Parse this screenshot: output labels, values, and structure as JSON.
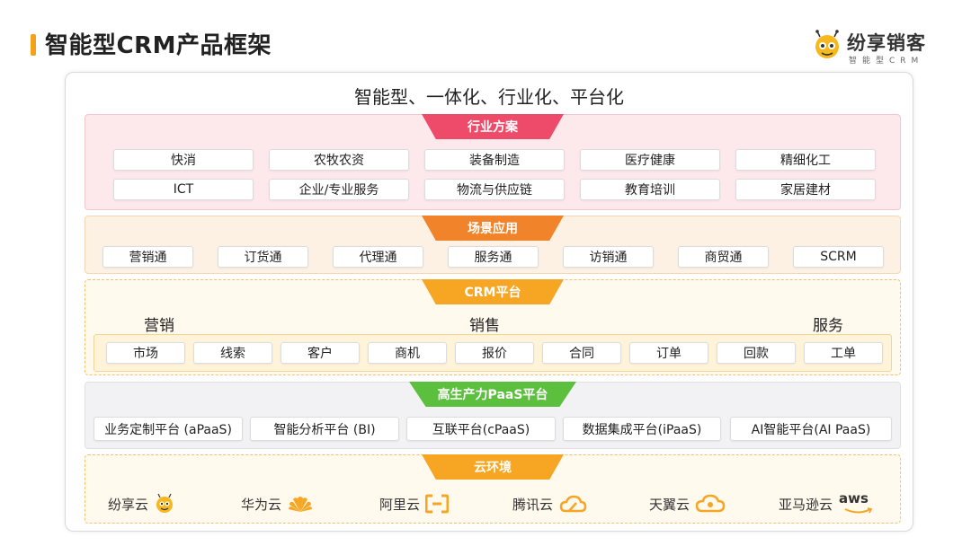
{
  "header": {
    "title": "智能型CRM产品框架",
    "logo_name": "纷享销客",
    "logo_sub": "智能型CRM"
  },
  "main_heading": "智能型、一体化、行业化、平台化",
  "industry": {
    "label": "行业方案",
    "row1": [
      "快消",
      "农牧农资",
      "装备制造",
      "医疗健康",
      "精细化工"
    ],
    "row2": [
      "ICT",
      "企业/专业服务",
      "物流与供应链",
      "教育培训",
      "家居建材"
    ]
  },
  "scene": {
    "label": "场景应用",
    "items": [
      "营销通",
      "订货通",
      "代理通",
      "服务通",
      "访销通",
      "商贸通",
      "SCRM"
    ]
  },
  "crm": {
    "label": "CRM平台",
    "groups": [
      "营销",
      "销售",
      "服务"
    ],
    "items": [
      "市场",
      "线索",
      "客户",
      "商机",
      "报价",
      "合同",
      "订单",
      "回款",
      "工单"
    ]
  },
  "paas": {
    "label": "高生产力PaaS平台",
    "items": [
      "业务定制平台 (aPaaS)",
      "智能分析平台 (BI)",
      "互联平台(cPaaS)",
      "数据集成平台(iPaaS)",
      "AI智能平台(AI PaaS)"
    ]
  },
  "cloud": {
    "label": "云环境",
    "items": [
      "纷享云",
      "华为云",
      "阿里云",
      "腾讯云",
      "天翼云",
      "亚马逊云"
    ],
    "aws_text": "aws"
  },
  "colors": {
    "accent": "#f5a21b",
    "industry_tab": "#ee4b6a",
    "scene_tab": "#f1842b",
    "crm_tab": "#f6a623",
    "paas_tab": "#5cbf3e"
  }
}
